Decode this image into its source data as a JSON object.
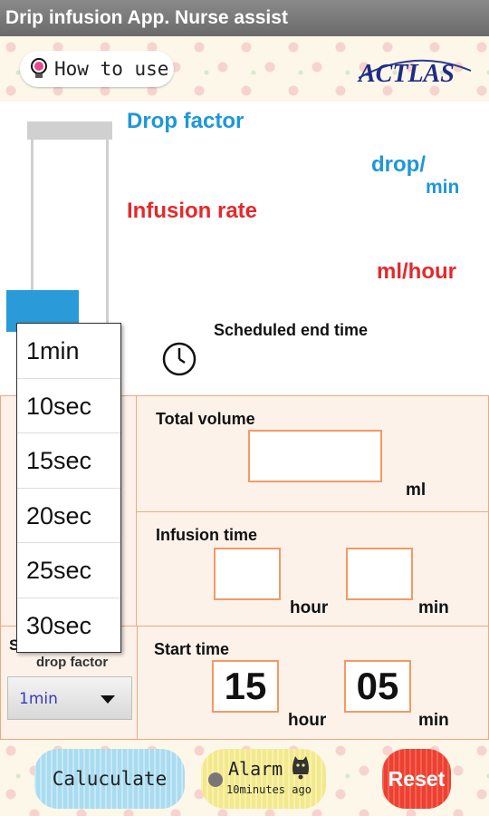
{
  "app": {
    "title": "Drip infusion App. Nurse assist"
  },
  "header": {
    "how_to_use": "How to use",
    "logo_text": "ACTLAS"
  },
  "labels": {
    "drop_factor": "Drop factor",
    "drop_unit_top": "drop/",
    "drop_unit_bottom": "min",
    "infusion_rate": "Infusion rate",
    "ml_hour": "ml/hour",
    "scheduled_end_time": "Scheduled end time"
  },
  "total_volume": {
    "label": "Total volume",
    "value": "",
    "unit": "ml"
  },
  "infusion_time": {
    "label": "Infusion time",
    "hour_value": "",
    "hour_unit": "hour",
    "min_value": "",
    "min_unit": "min"
  },
  "start_time": {
    "label": "Start time",
    "hour_value": "15",
    "hour_unit": "hour",
    "min_value": "05",
    "min_unit": "min"
  },
  "drop_factor_select": {
    "left_label": "S",
    "label": "drop factor",
    "selected": "1min"
  },
  "dropdown_options": [
    "1min",
    "10sec",
    "15sec",
    "20sec",
    "25sec",
    "30sec"
  ],
  "footer": {
    "calculate": "Caluculate",
    "alarm_title": "Alarm",
    "alarm_sub": "10minutes ago",
    "reset": "Reset"
  },
  "colors": {
    "blue": "#1e97d8",
    "red": "#e5292b",
    "orange_border": "#f39a64"
  }
}
